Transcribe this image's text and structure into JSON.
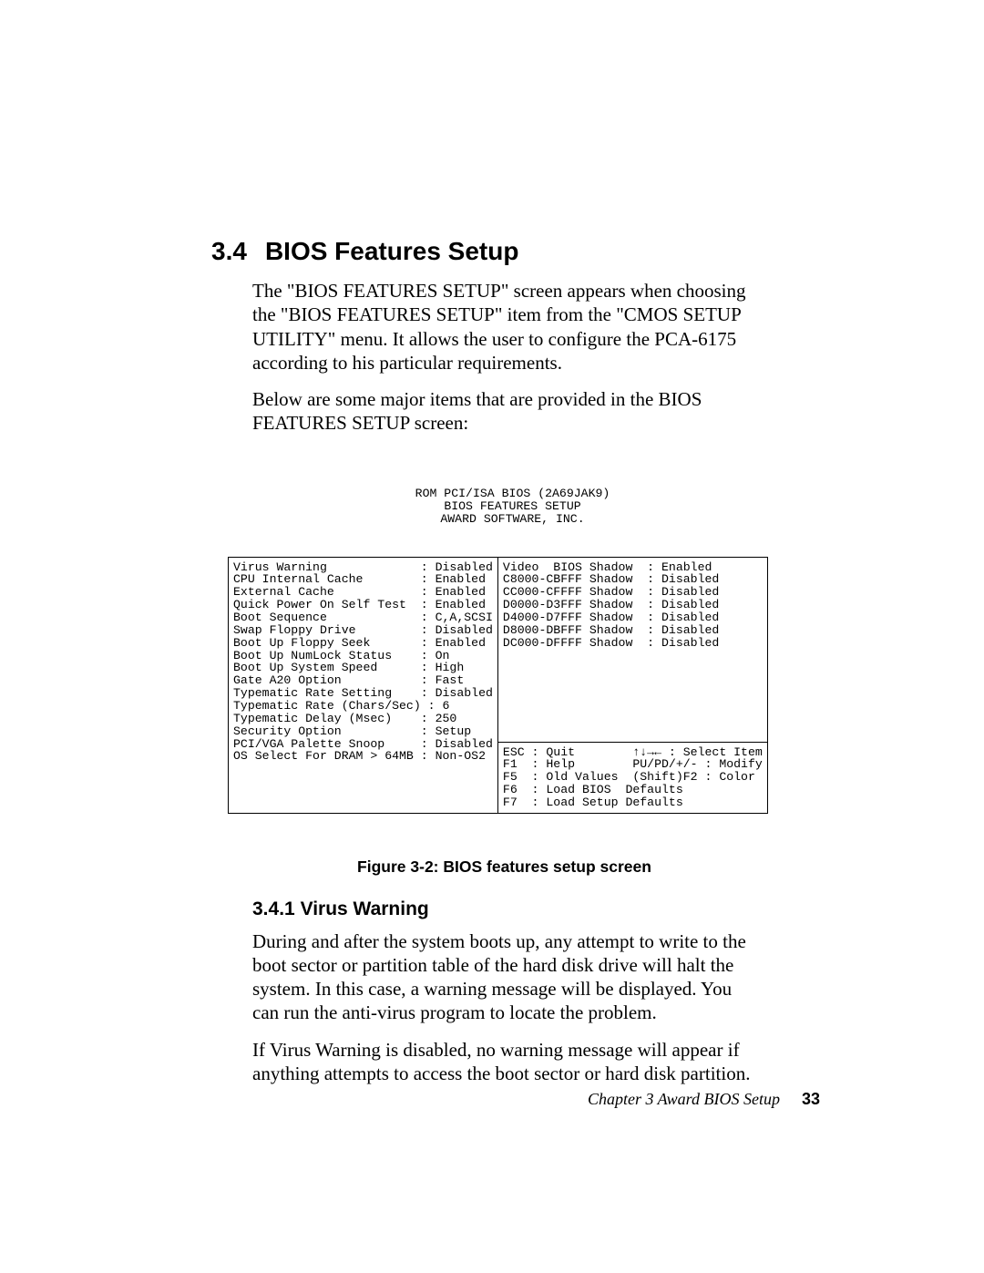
{
  "section": {
    "number": "3.4",
    "title": "BIOS Features Setup",
    "para1": "The \"BIOS FEATURES SETUP\" screen appears when choosing the \"BIOS FEATURES SETUP\" item from the \"CMOS SETUP UTILITY\" menu. It allows the user to configure the PCA-6175 according to his particular requirements.",
    "para2": "Below are some major items that are provided in the BIOS FEATURES SETUP screen:"
  },
  "bios": {
    "header_line1": "ROM PCI/ISA BIOS (2A69JAK9)",
    "header_line2": "BIOS FEATURES SETUP",
    "header_line3": "AWARD SOFTWARE, INC.",
    "left_top": "Virus Warning             : Disabled\nCPU Internal Cache        : Enabled\nExternal Cache            : Enabled\nQuick Power On Self Test  : Enabled\nBoot Sequence             : C,A,SCSI\nSwap Floppy Drive         : Disabled\nBoot Up Floppy Seek       : Enabled\nBoot Up NumLock Status    : On\nBoot Up System Speed      : High\nGate A20 Option           : Fast\nTypematic Rate Setting    : Disabled\nTypematic Rate (Chars/Sec) : 6\nTypematic Delay (Msec)    : 250\nSecurity Option           : Setup\nPCI/VGA Palette Snoop     : Disabled",
    "left_bottom": "OS Select For DRAM > 64MB : Non-OS2\n\n\n\n",
    "right_top": "Video  BIOS Shadow  : Enabled\nC8000-CBFFF Shadow  : Disabled\nCC000-CFFFF Shadow  : Disabled\nD0000-D3FFF Shadow  : Disabled\nD4000-D7FFF Shadow  : Disabled\nD8000-DBFFF Shadow  : Disabled\nDC000-DFFFF Shadow  : Disabled\n\n\n\n\n\n\n\n",
    "right_bottom": "ESC : Quit        ↑↓→← : Select Item\nF1  : Help        PU/PD/+/- : Modify\nF5  : Old Values  (Shift)F2 : Color\nF6  : Load BIOS  Defaults\nF7  : Load Setup Defaults"
  },
  "caption": "Figure 3-2: BIOS features setup screen",
  "subsection": {
    "number": "3.4.1",
    "title": "Virus Warning",
    "para1": "During and after the system boots up, any attempt to write to the boot sector or partition table of the hard disk drive will halt the system. In this case, a warning message will be displayed. You can run the anti-virus program to locate the problem.",
    "para2": "If Virus Warning is disabled, no warning message will appear if anything attempts to access the boot sector or hard disk partition."
  },
  "footer": {
    "chapter": "Chapter 3  Award BIOS Setup",
    "page": "33"
  }
}
